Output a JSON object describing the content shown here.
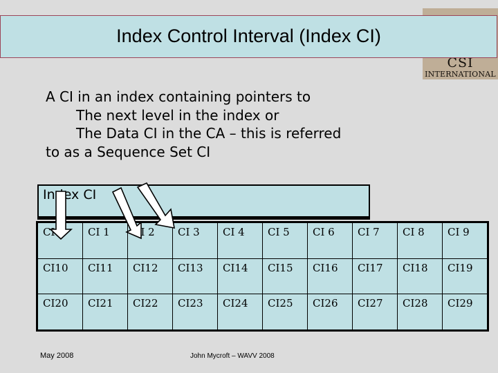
{
  "slide": {
    "title": "Index Control Interval (Index CI)",
    "background_color": "#dcdcdc",
    "accent_color": "#bfe0e4",
    "title_border_color": "#9c4558",
    "logo_plate_color": "#bfae97"
  },
  "logo": {
    "main": "CSI",
    "sub": "INTERNATIONAL"
  },
  "body": {
    "lines": [
      "A CI in an index containing pointers to",
      "The next level in the index or",
      "The Data CI in the CA – this is referred",
      "to as a Sequence Set CI"
    ]
  },
  "diagram": {
    "index_ci_label": "Index CI",
    "arrows": [
      "arrow-down",
      "arrow-down-right",
      "arrow-down-right"
    ],
    "table": {
      "rows": [
        [
          "CI 0",
          "CI 1",
          "CI 2",
          "CI 3",
          "CI 4",
          "CI 5",
          "CI 6",
          "CI 7",
          "CI 8",
          "CI 9"
        ],
        [
          "CI10",
          "CI11",
          "CI12",
          "CI13",
          "CI14",
          "CI15",
          "CI16",
          "CI17",
          "CI18",
          "CI19"
        ],
        [
          "CI20",
          "CI21",
          "CI22",
          "CI23",
          "CI24",
          "CI25",
          "CI26",
          "CI27",
          "CI28",
          "CI29"
        ]
      ]
    }
  },
  "footer": {
    "date": "May 2008",
    "credit": "John Mycroft – WAVV 2008"
  }
}
